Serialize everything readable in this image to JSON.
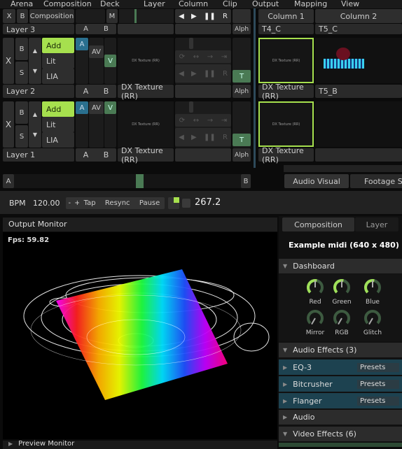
{
  "menu": [
    "Arena",
    "Composition",
    "Deck",
    "Layer",
    "Column",
    "Clip",
    "Output",
    "Mapping",
    "View"
  ],
  "comp_bar": {
    "x": "X",
    "b": "B",
    "composition": "Composition",
    "m": "M",
    "transport": [
      "◀",
      "▶",
      "❚❚",
      "R"
    ]
  },
  "columns": [
    "Column 1",
    "Column 2"
  ],
  "layers": [
    {
      "name": "Layer 3",
      "a": "A",
      "b": "B",
      "alpha": "Alph",
      "clips": [
        "T4_C",
        "T5_C"
      ]
    },
    {
      "name": "Layer 2",
      "x": "X",
      "b": "B",
      "s": "S",
      "blend": [
        "Add",
        "Lit",
        "LIA"
      ],
      "a_btn": "A",
      "av": "AV",
      "v": "V",
      "t": "T",
      "preview": "DX Texture (RR)",
      "clip_label": "DX Texture (RR)",
      "alpha": "Alph",
      "clips": [
        "DX Texture (RR)",
        "T5_B"
      ],
      "thumb": "DX Texture (RR)",
      "active": false
    },
    {
      "name": "Layer 1",
      "x": "X",
      "b": "B",
      "s": "S",
      "blend": [
        "Add",
        "Lit",
        "LIA"
      ],
      "a_btn": "A",
      "av": "AV",
      "v": "V",
      "t": "T",
      "preview": "DX Texture (RR)",
      "clip_label": "DX Texture (RR)",
      "alpha": "Alph",
      "clips": [
        "DX Texture (RR)",
        ""
      ],
      "thumb": "DX Texture (RR)",
      "active": true
    }
  ],
  "crossfader": {
    "a": "A",
    "b": "B",
    "position": 0.5
  },
  "deck_tabs": [
    "Audio Visual",
    "Footage S"
  ],
  "bpm": {
    "label": "BPM",
    "value": "120.00",
    "minus": "-",
    "plus": "+",
    "tap": "Tap",
    "resync": "Resync",
    "pause": "Pause",
    "time": "267.2"
  },
  "output_monitor": {
    "title": "Output Monitor",
    "fps": "Fps: 59.82",
    "preview": "Preview Monitor"
  },
  "right_panel": {
    "tabs": [
      "Composition",
      "Layer"
    ],
    "title": "Example midi (640 x 480)",
    "dashboard": "Dashboard",
    "knobs": [
      {
        "label": "Red",
        "value": 0.55
      },
      {
        "label": "Green",
        "value": 0.55
      },
      {
        "label": "Blue",
        "value": 0.55
      },
      {
        "label": "Mirror",
        "value": 0
      },
      {
        "label": "RGB",
        "value": 0
      },
      {
        "label": "Glitch",
        "value": 0
      }
    ],
    "audio_effects": "Audio Effects (3)",
    "effects": [
      {
        "name": "EQ-3",
        "presets": "Presets"
      },
      {
        "name": "Bitcrusher",
        "presets": "Presets"
      },
      {
        "name": "Flanger",
        "presets": "Presets"
      }
    ],
    "audio": "Audio",
    "video_effects": "Video Effects (6)"
  },
  "colors": {
    "accent": "#a6e04e",
    "fx": "#1d4250",
    "blue": "#2a6f8e"
  }
}
